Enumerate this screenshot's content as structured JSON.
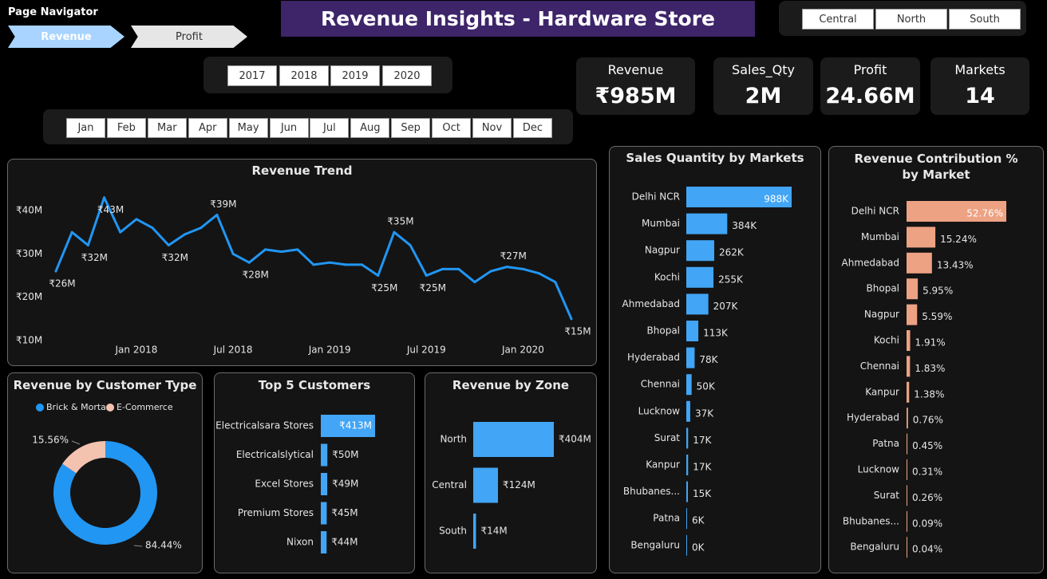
{
  "nav": {
    "title": "Page Navigator",
    "revenue_label": "Revenue",
    "profit_label": "Profit"
  },
  "title": "Revenue Insights - Hardware Store",
  "zones_filter": [
    "Central",
    "North",
    "South"
  ],
  "years": [
    "2017",
    "2018",
    "2019",
    "2020"
  ],
  "months": [
    "Jan",
    "Feb",
    "Mar",
    "Apr",
    "May",
    "Jun",
    "Jul",
    "Aug",
    "Sep",
    "Oct",
    "Nov",
    "Dec"
  ],
  "kpis": [
    {
      "label": "Revenue",
      "value": "₹985M"
    },
    {
      "label": "Sales_Qty",
      "value": "2M"
    },
    {
      "label": "Profit",
      "value": "24.66M"
    },
    {
      "label": "Markets",
      "value": "14"
    }
  ],
  "colors": {
    "blue": "#3d9bf5",
    "bright_blue": "#2196f3",
    "salmon": "#eda283",
    "peach": "#f4c3b0",
    "title_purple": "#3e2469"
  },
  "chart_data": [
    {
      "id": "revenue_trend",
      "type": "line",
      "title": "Revenue Trend",
      "x_tick_labels": [
        "Jan 2018",
        "Jul 2018",
        "Jan 2019",
        "Jul 2019",
        "Jan 2020"
      ],
      "x_tick_index": [
        5,
        11,
        17,
        23,
        29
      ],
      "y_tick_labels": [
        "₹10M",
        "₹20M",
        "₹30M",
        "₹40M"
      ],
      "y_ticks": [
        10,
        20,
        30,
        40
      ],
      "ylim": [
        10,
        42
      ],
      "values": [
        26,
        35,
        32,
        43,
        35,
        38,
        36,
        32,
        34.5,
        36,
        39,
        30,
        28,
        31,
        30.5,
        31,
        27.5,
        28,
        27.5,
        27.5,
        25,
        35,
        32,
        25,
        26.5,
        26.5,
        23.5,
        26,
        27,
        26.5,
        25.5,
        23.5,
        15
      ],
      "point_labels": [
        {
          "i": 0,
          "text": "₹26M",
          "pos": "below"
        },
        {
          "i": 2,
          "text": "₹32M",
          "pos": "below"
        },
        {
          "i": 3,
          "text": "₹43M",
          "pos": "below"
        },
        {
          "i": 7,
          "text": "₹32M",
          "pos": "below"
        },
        {
          "i": 10,
          "text": "₹39M",
          "pos": "above"
        },
        {
          "i": 12,
          "text": "₹28M",
          "pos": "below"
        },
        {
          "i": 20,
          "text": "₹25M",
          "pos": "below"
        },
        {
          "i": 21,
          "text": "₹35M",
          "pos": "above"
        },
        {
          "i": 23,
          "text": "₹25M",
          "pos": "below"
        },
        {
          "i": 28,
          "text": "₹27M",
          "pos": "above"
        },
        {
          "i": 32,
          "text": "₹15M",
          "pos": "below"
        }
      ]
    },
    {
      "id": "customer_type",
      "type": "pie",
      "title": "Revenue by Customer Type",
      "slices": [
        {
          "name": "Brick & Mortar",
          "value": 84.44,
          "label": "84.44%",
          "color": "#2196f3"
        },
        {
          "name": "E-Commerce",
          "value": 15.56,
          "label": "15.56%",
          "color": "#f4c3b0"
        }
      ]
    },
    {
      "id": "top_customers",
      "type": "bar",
      "title": "Top 5 Customers",
      "categories": [
        "Electricalsara Stores",
        "Electricalslytical",
        "Excel Stores",
        "Premium Stores",
        "Nixon"
      ],
      "values": [
        413,
        50,
        49,
        45,
        44
      ],
      "labels": [
        "₹413M",
        "₹50M",
        "₹49M",
        "₹45M",
        "₹44M"
      ]
    },
    {
      "id": "zone",
      "type": "bar",
      "title": "Revenue by Zone",
      "categories": [
        "North",
        "Central",
        "South"
      ],
      "values": [
        404,
        124,
        14
      ],
      "labels": [
        "₹404M",
        "₹124M",
        "₹14M"
      ]
    },
    {
      "id": "sales_qty",
      "type": "bar",
      "title": "Sales Quantity by Markets",
      "categories": [
        "Delhi NCR",
        "Mumbai",
        "Nagpur",
        "Kochi",
        "Ahmedabad",
        "Bhopal",
        "Hyderabad",
        "Chennai",
        "Lucknow",
        "Surat",
        "Kanpur",
        "Bhubanes...",
        "Patna",
        "Bengaluru"
      ],
      "values": [
        988,
        384,
        262,
        255,
        207,
        113,
        78,
        50,
        37,
        17,
        17,
        15,
        6,
        0
      ],
      "labels": [
        "988K",
        "384K",
        "262K",
        "255K",
        "207K",
        "113K",
        "78K",
        "50K",
        "37K",
        "17K",
        "17K",
        "15K",
        "6K",
        "0K"
      ]
    },
    {
      "id": "revenue_contribution",
      "type": "bar",
      "title": "Revenue Contribution % by Market",
      "categories": [
        "Delhi NCR",
        "Mumbai",
        "Ahmedabad",
        "Bhopal",
        "Nagpur",
        "Kochi",
        "Chennai",
        "Kanpur",
        "Hyderabad",
        "Patna",
        "Lucknow",
        "Surat",
        "Bhubanes...",
        "Bengaluru"
      ],
      "values": [
        52.76,
        15.24,
        13.43,
        5.95,
        5.59,
        1.91,
        1.83,
        1.38,
        0.76,
        0.45,
        0.31,
        0.26,
        0.09,
        0.04
      ],
      "labels": [
        "52.76%",
        "15.24%",
        "13.43%",
        "5.95%",
        "5.59%",
        "1.91%",
        "1.83%",
        "1.38%",
        "0.76%",
        "0.45%",
        "0.31%",
        "0.26%",
        "0.09%",
        "0.04%"
      ]
    }
  ]
}
